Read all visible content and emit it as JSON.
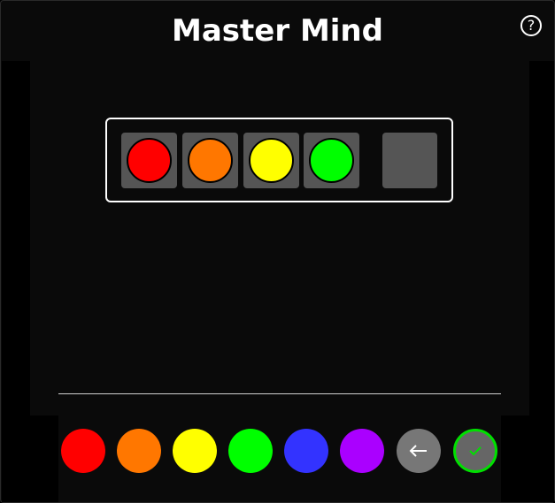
{
  "title": "Master Mind",
  "help_label": "?",
  "current_guess": [
    {
      "color": "#ff0000",
      "name": "red"
    },
    {
      "color": "#ff7700",
      "name": "orange"
    },
    {
      "color": "#ffff00",
      "name": "yellow"
    },
    {
      "color": "#00ff00",
      "name": "green"
    }
  ],
  "palette": [
    {
      "color": "#ff0000",
      "name": "red"
    },
    {
      "color": "#ff7700",
      "name": "orange"
    },
    {
      "color": "#ffff00",
      "name": "yellow"
    },
    {
      "color": "#00ff00",
      "name": "green"
    },
    {
      "color": "#3333ff",
      "name": "blue"
    },
    {
      "color": "#aa00ff",
      "name": "purple"
    }
  ],
  "controls": {
    "back_icon": "arrow-left-icon",
    "submit_icon": "check-icon",
    "submit_accent": "#00e000"
  }
}
